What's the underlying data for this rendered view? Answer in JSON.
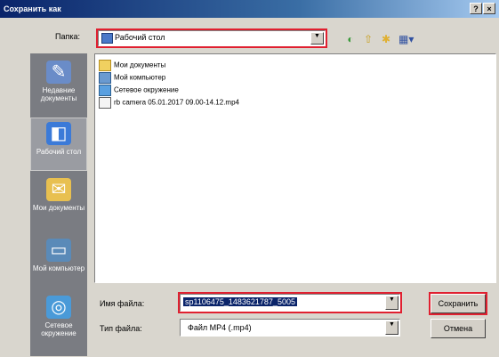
{
  "window": {
    "title": "Сохранить как",
    "help": "?",
    "close": "×"
  },
  "lookin": {
    "label": "Папка:",
    "value": "Рабочий стол"
  },
  "places": [
    {
      "label": "Недавние документы",
      "icon": "recent-documents-icon"
    },
    {
      "label": "Рабочий стол",
      "icon": "desktop-icon"
    },
    {
      "label": "Мои документы",
      "icon": "my-documents-icon"
    },
    {
      "label": "Мой компьютер",
      "icon": "my-computer-icon"
    },
    {
      "label": "Сетевое окружение",
      "icon": "network-places-icon"
    }
  ],
  "files": [
    {
      "name": "Мои документы",
      "icon": "folder-icon"
    },
    {
      "name": "Мой компьютер",
      "icon": "computer-icon"
    },
    {
      "name": "Сетевое окружение",
      "icon": "network-icon"
    },
    {
      "name": "rb camera 05.01.2017 09.00-14.12.mp4",
      "icon": "video-file-icon"
    }
  ],
  "filename": {
    "label": "Имя файла:",
    "value": "sp1106475_1483621787_5005"
  },
  "filetype": {
    "label": "Тип файла:",
    "value": "Файл MP4 (.mp4)"
  },
  "buttons": {
    "save": "Сохранить",
    "cancel": "Отмена"
  }
}
